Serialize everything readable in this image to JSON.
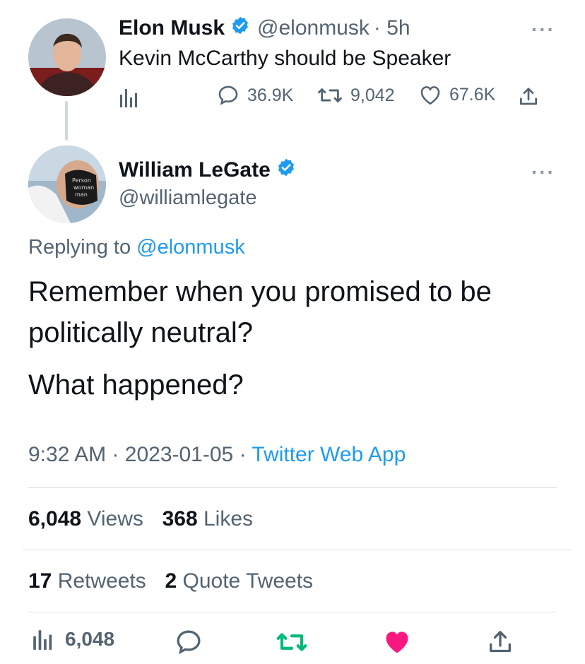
{
  "parent_tweet": {
    "author_name": "Elon Musk",
    "handle": "@elonmusk",
    "time": "· 5h",
    "text": "Kevin McCarthy should be Speaker",
    "more_label": "···",
    "stats": {
      "replies": "36.9K",
      "retweets": "9,042",
      "likes": "67.6K"
    }
  },
  "reply_tweet": {
    "author_name": "William LeGate",
    "handle": "@williamlegate",
    "more_label": "···",
    "replying_prefix": "Replying to",
    "replying_handle": "@elonmusk",
    "line1": "Remember when you promised to be",
    "line2": "politically neutral?",
    "line3": "What happened?",
    "time": "9:32 AM",
    "date": "2023-01-05",
    "separator": "·",
    "source": "Twitter Web App",
    "views_count": "6,048",
    "views_label": "Views",
    "likes_count": "368",
    "likes_label": "Likes",
    "retweets_count": "17",
    "retweets_label": "Retweets",
    "quotes_count": "2",
    "quotes_label": "Quote Tweets"
  },
  "action_bar": {
    "views_count": "6,048"
  },
  "colors": {
    "accent": "#1d9bf0",
    "retweet_green": "#00ba7c",
    "like_pink": "#f91880",
    "muted": "#536471"
  },
  "icons": {
    "verified": "verified-badge-icon",
    "analytics": "analytics-bars-icon",
    "reply": "speech-bubble-icon",
    "retweet": "retweet-arrows-icon",
    "like": "heart-icon",
    "share": "share-upload-icon",
    "more": "more-dots-icon"
  }
}
